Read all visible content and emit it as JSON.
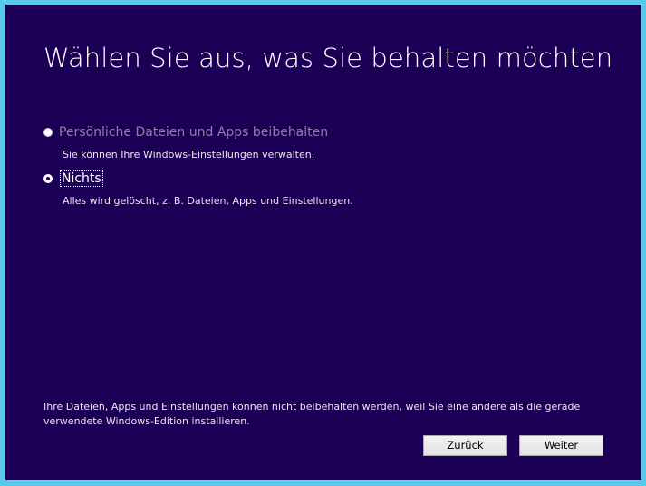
{
  "window": {
    "title": "Wählen Sie aus, was Sie behalten möchten"
  },
  "options": [
    {
      "label": "Persönliche Dateien und Apps beibehalten",
      "description": "Sie können Ihre Windows-Einstellungen verwalten.",
      "state": "disabled"
    },
    {
      "label": "Nichts",
      "description": "Alles wird gelöscht, z. B. Dateien, Apps und Einstellungen.",
      "state": "selected"
    }
  ],
  "footnote": {
    "line1": "Ihre Dateien, Apps und Einstellungen können nicht beibehalten werden, weil Sie eine andere als die gerade",
    "line2": "verwendete Windows-Edition installieren."
  },
  "buttons": {
    "back_label": "Zurück",
    "next_label": "Weiter"
  },
  "colors": {
    "background": "#1c0056",
    "frame": "#5ac8e8",
    "disabled_text": "#8a80a8"
  }
}
